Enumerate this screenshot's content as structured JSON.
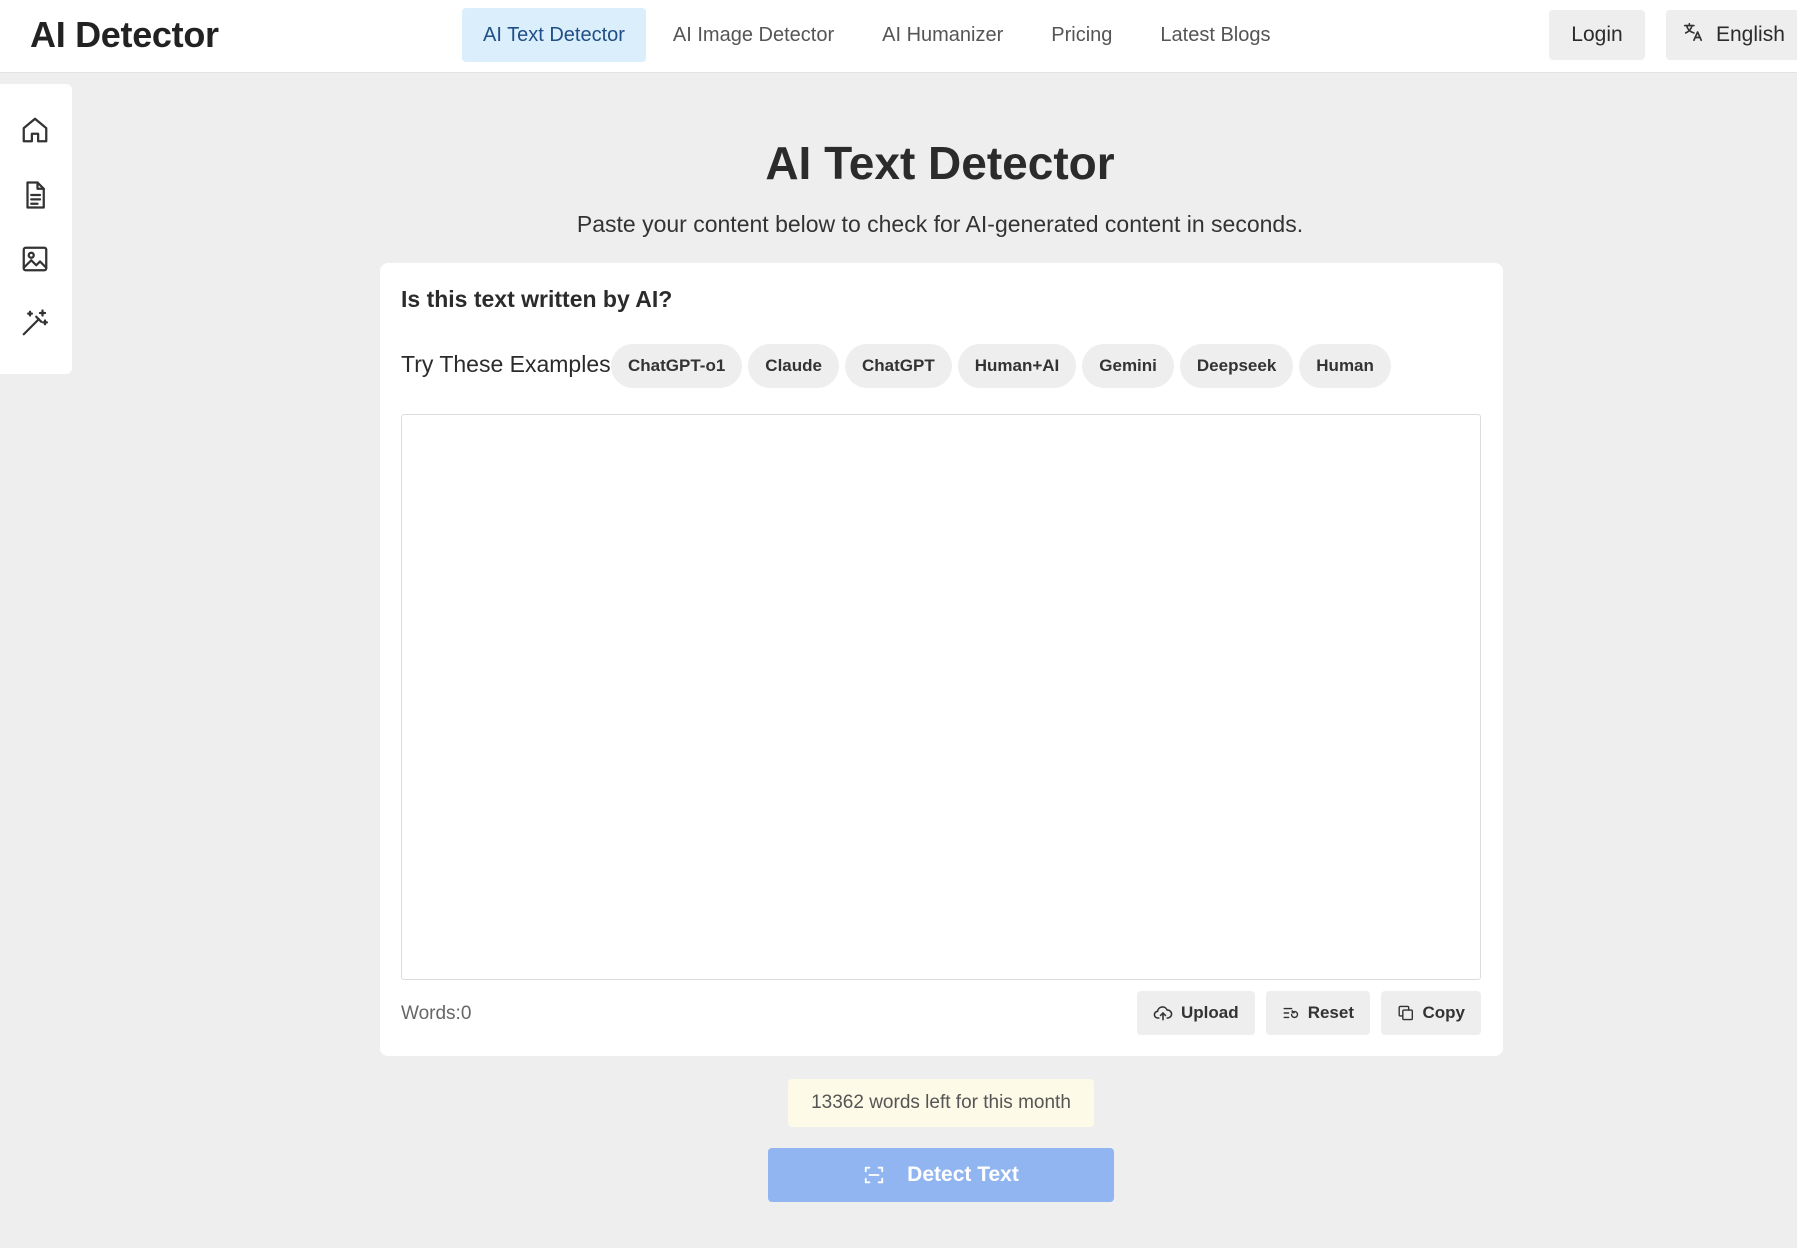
{
  "header": {
    "logo": "AI Detector",
    "nav": [
      {
        "label": "AI Text Detector",
        "active": true
      },
      {
        "label": "AI Image Detector",
        "active": false
      },
      {
        "label": "AI Humanizer",
        "active": false
      },
      {
        "label": "Pricing",
        "active": false
      },
      {
        "label": "Latest Blogs",
        "active": false
      }
    ],
    "login_label": "Login",
    "language_label": "English"
  },
  "sidebar": {
    "icons": [
      "home-icon",
      "document-icon",
      "image-icon",
      "magic-wand-icon"
    ]
  },
  "main": {
    "title": "AI Text Detector",
    "subtitle": "Paste your content below to check for AI-generated content in seconds.",
    "card": {
      "heading": "Is this text written by AI?",
      "examples_label": "Try These Examples:",
      "examples": [
        "ChatGPT-o1",
        "Claude",
        "ChatGPT",
        "Human+AI",
        "Gemini",
        "Deepseek",
        "Human"
      ],
      "input_value": "",
      "word_count": "Words:0",
      "upload_label": "Upload",
      "reset_label": "Reset",
      "copy_label": "Copy"
    },
    "quota_text": "13362 words left for this month",
    "detect_label": "Detect Text"
  },
  "colors": {
    "accent": "#90b5f1",
    "nav_active_bg": "#dbeefb",
    "nav_active_text": "#1f4f86",
    "quota_bg": "#fdfae8",
    "page_bg": "#eeeeee"
  }
}
